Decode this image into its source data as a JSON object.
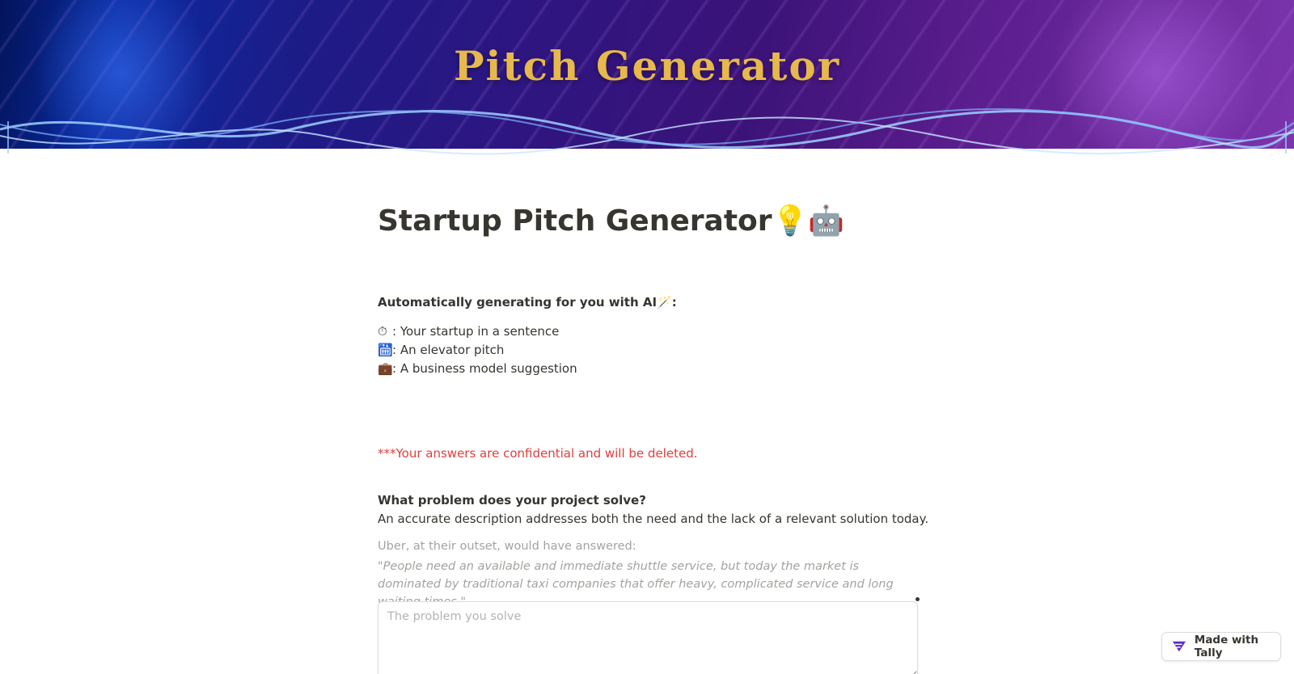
{
  "banner": {
    "title": "Pitch Generator"
  },
  "form": {
    "title": "Startup Pitch Generator💡🤖",
    "intro_heading": "Automatically generating for you with AI🪄:",
    "features": [
      {
        "icon": "⏱",
        "icon_name": "stopwatch-icon",
        "text": ": Your startup in a sentence"
      },
      {
        "icon": "🛗",
        "icon_name": "elevator-icon",
        "text": ": An elevator pitch"
      },
      {
        "icon": "💼",
        "icon_name": "briefcase-icon",
        "text": ": A business model suggestion"
      }
    ],
    "confidential_notice": "***Your answers are confidential and will be deleted.",
    "question": {
      "title": "What problem does your project solve?",
      "description": "An accurate description addresses both the need and the lack of a relevant solution today.",
      "example_intro": "Uber, at their outset, would have answered:",
      "example_quote": "\"People need an available and immediate shuttle service, but today the market is dominated by traditional taxi companies that offer heavy, complicated service and long waiting times.\"",
      "answer_value": "",
      "answer_placeholder": "The problem you solve"
    }
  },
  "badge": {
    "label": "Made with Tally",
    "icon_name": "tally-logo-icon"
  },
  "colors": {
    "banner_title": "#e7b84b",
    "notice_red": "#e03e3e",
    "text": "#37352f",
    "muted": "#a3a29e",
    "tally_purple": "#5b2dc8"
  }
}
